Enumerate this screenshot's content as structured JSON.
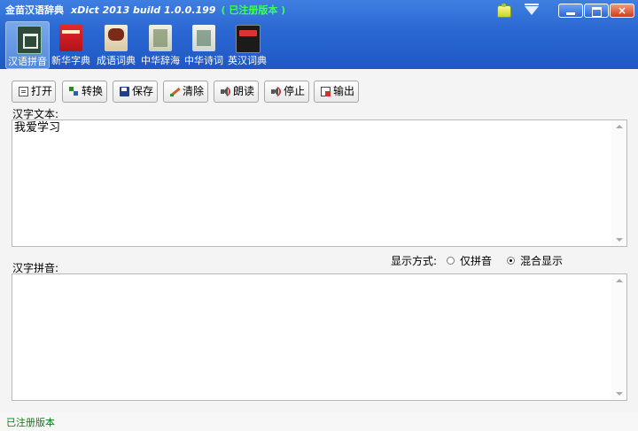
{
  "window": {
    "app_name": "金苗汉语辞典",
    "version": "xDict 2013  build 1.0.0.199",
    "registration": "( 已注册版本 )",
    "close_glyph": "×"
  },
  "nav": {
    "items": [
      {
        "label": "汉语拼音",
        "icon": "pinyin-book-icon"
      },
      {
        "label": "新华字典",
        "icon": "xinhua-dictionary-icon"
      },
      {
        "label": "成语词典",
        "icon": "idiom-dictionary-icon"
      },
      {
        "label": "中华辞海",
        "icon": "cihai-icon"
      },
      {
        "label": "中华诗词",
        "icon": "poetry-icon"
      },
      {
        "label": "英汉词典",
        "icon": "english-chinese-dictionary-icon"
      }
    ],
    "active_index": 0
  },
  "toolbar": {
    "open": "打开",
    "convert": "转换",
    "save": "保存",
    "clear": "清除",
    "read": "朗读",
    "stop": "停止",
    "export": "输出"
  },
  "input": {
    "label": "汉字文本:",
    "value": "我爱学习"
  },
  "output": {
    "label": "汉字拼音:",
    "value": ""
  },
  "display_mode": {
    "label": "显示方式:",
    "options": [
      "仅拼音",
      "混合显示"
    ],
    "selected": "混合显示"
  },
  "status": {
    "text": "已注册版本"
  }
}
